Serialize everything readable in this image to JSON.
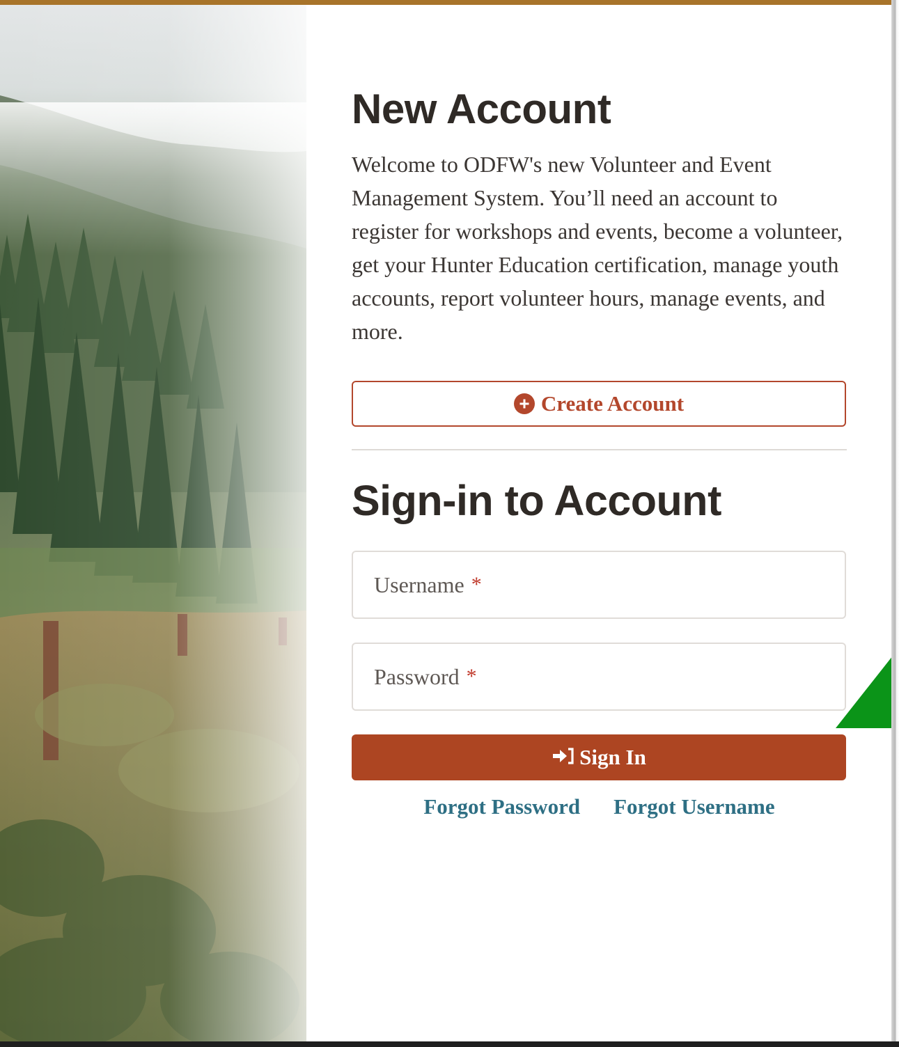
{
  "new_account": {
    "heading": "New Account",
    "welcome_text": "Welcome to ODFW's new Volunteer and Event Management System. You’ll need an account to register for workshops and events, become a volunteer, get your Hunter Education certification, manage youth accounts, report volunteer hours, manage events, and more.",
    "create_button_label": "Create Account",
    "create_button_icon": "plus-circle-icon"
  },
  "sign_in": {
    "heading": "Sign-in to Account",
    "username_label": "Username",
    "password_label": "Password",
    "required_marker": "*",
    "signin_button_label": "Sign In",
    "signin_button_icon": "sign-in-icon",
    "forgot_password_label": "Forgot Password",
    "forgot_username_label": "Forgot Username"
  },
  "colors": {
    "top_bar": "#a8742a",
    "accent": "#b3472c",
    "signin_button": "#ad4522",
    "link": "#2e6f84",
    "required": "#c0392b",
    "heading": "#2f2a26",
    "triangle": "#0b9418"
  }
}
